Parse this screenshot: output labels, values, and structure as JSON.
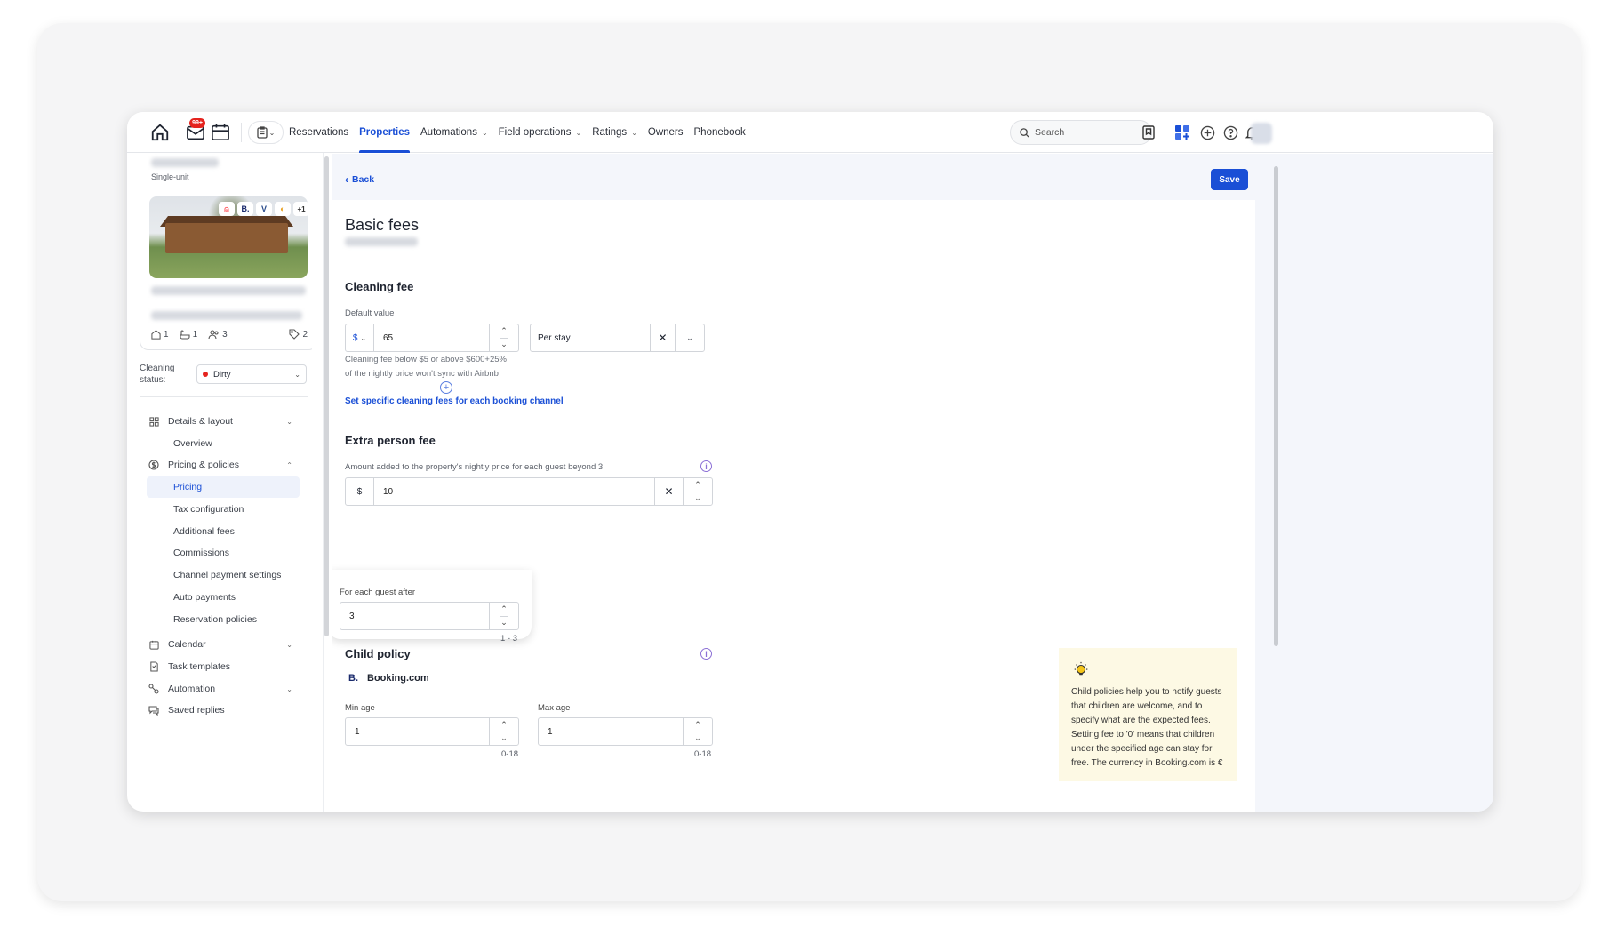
{
  "nav": {
    "badge": "99+",
    "links": [
      {
        "label": "Reservations",
        "dropdown": false,
        "active": false
      },
      {
        "label": "Properties",
        "dropdown": false,
        "active": true
      },
      {
        "label": "Automations",
        "dropdown": true,
        "active": false
      },
      {
        "label": "Field operations",
        "dropdown": true,
        "active": false
      },
      {
        "label": "Ratings",
        "dropdown": true,
        "active": false
      },
      {
        "label": "Owners",
        "dropdown": false,
        "active": false
      },
      {
        "label": "Phonebook",
        "dropdown": false,
        "active": false
      }
    ],
    "search_placeholder": "Search"
  },
  "sidebar": {
    "property_type": "Single-unit",
    "channels_more": "+1",
    "stats": {
      "buildings": "1",
      "bathrooms": "1",
      "guests": "3",
      "tags": "2"
    },
    "cleaning_label": "Cleaning status:",
    "cleaning_value": "Dirty",
    "menu": [
      {
        "label": "Details & layout",
        "icon": "grid-icon",
        "type": "group",
        "expanded": false
      },
      {
        "label": "Overview",
        "type": "sub"
      },
      {
        "label": "Pricing & policies",
        "icon": "dollar-icon",
        "type": "group",
        "expanded": true
      },
      {
        "label": "Pricing",
        "type": "sub",
        "selected": true
      },
      {
        "label": "Tax configuration",
        "type": "sub"
      },
      {
        "label": "Additional fees",
        "type": "sub"
      },
      {
        "label": "Commissions",
        "type": "sub"
      },
      {
        "label": "Channel payment settings",
        "type": "sub"
      },
      {
        "label": "Auto payments",
        "type": "sub"
      },
      {
        "label": "Reservation policies",
        "type": "sub"
      },
      {
        "label": "Calendar",
        "icon": "calendar-icon",
        "type": "group",
        "expanded": false
      },
      {
        "label": "Task templates",
        "icon": "task-icon",
        "type": "item"
      },
      {
        "label": "Automation",
        "icon": "automation-icon",
        "type": "group",
        "expanded": false
      },
      {
        "label": "Saved replies",
        "icon": "chat-icon",
        "type": "item"
      }
    ]
  },
  "main": {
    "back_label": "Back",
    "save_label": "Save",
    "title": "Basic fees",
    "cleaning": {
      "heading": "Cleaning fee",
      "default_label": "Default value",
      "currency": "$",
      "value": "65",
      "per": "Per stay",
      "hint_line1": "Cleaning fee below $5 or above $600+25%",
      "hint_line2": "of the nightly price won't sync with Airbnb",
      "link": "Set specific cleaning fees for each booking channel"
    },
    "extra": {
      "heading": "Extra person fee",
      "desc": "Amount added to the property's nightly price for each guest beyond 3",
      "currency": "$",
      "value": "10",
      "guest_after_label": "For each guest after",
      "guest_after_value": "3",
      "guest_after_range": "1 - 3"
    },
    "child": {
      "heading": "Child policy",
      "channel_logo": "B.",
      "channel": "Booking.com",
      "min_label": "Min age",
      "min_value": "1",
      "min_range": "0-18",
      "max_label": "Max age",
      "max_value": "1",
      "max_range": "0-18"
    },
    "tip": "Child policies help you to notify guests that children are welcome, and to specify what are the expected fees. Setting fee to '0' means that children under the specified age can stay for free. The currency in Booking.com is €"
  },
  "colors": {
    "accent": "#1a4fd6",
    "badge": "#e5231e",
    "tip_bg": "#fdf9e4"
  }
}
